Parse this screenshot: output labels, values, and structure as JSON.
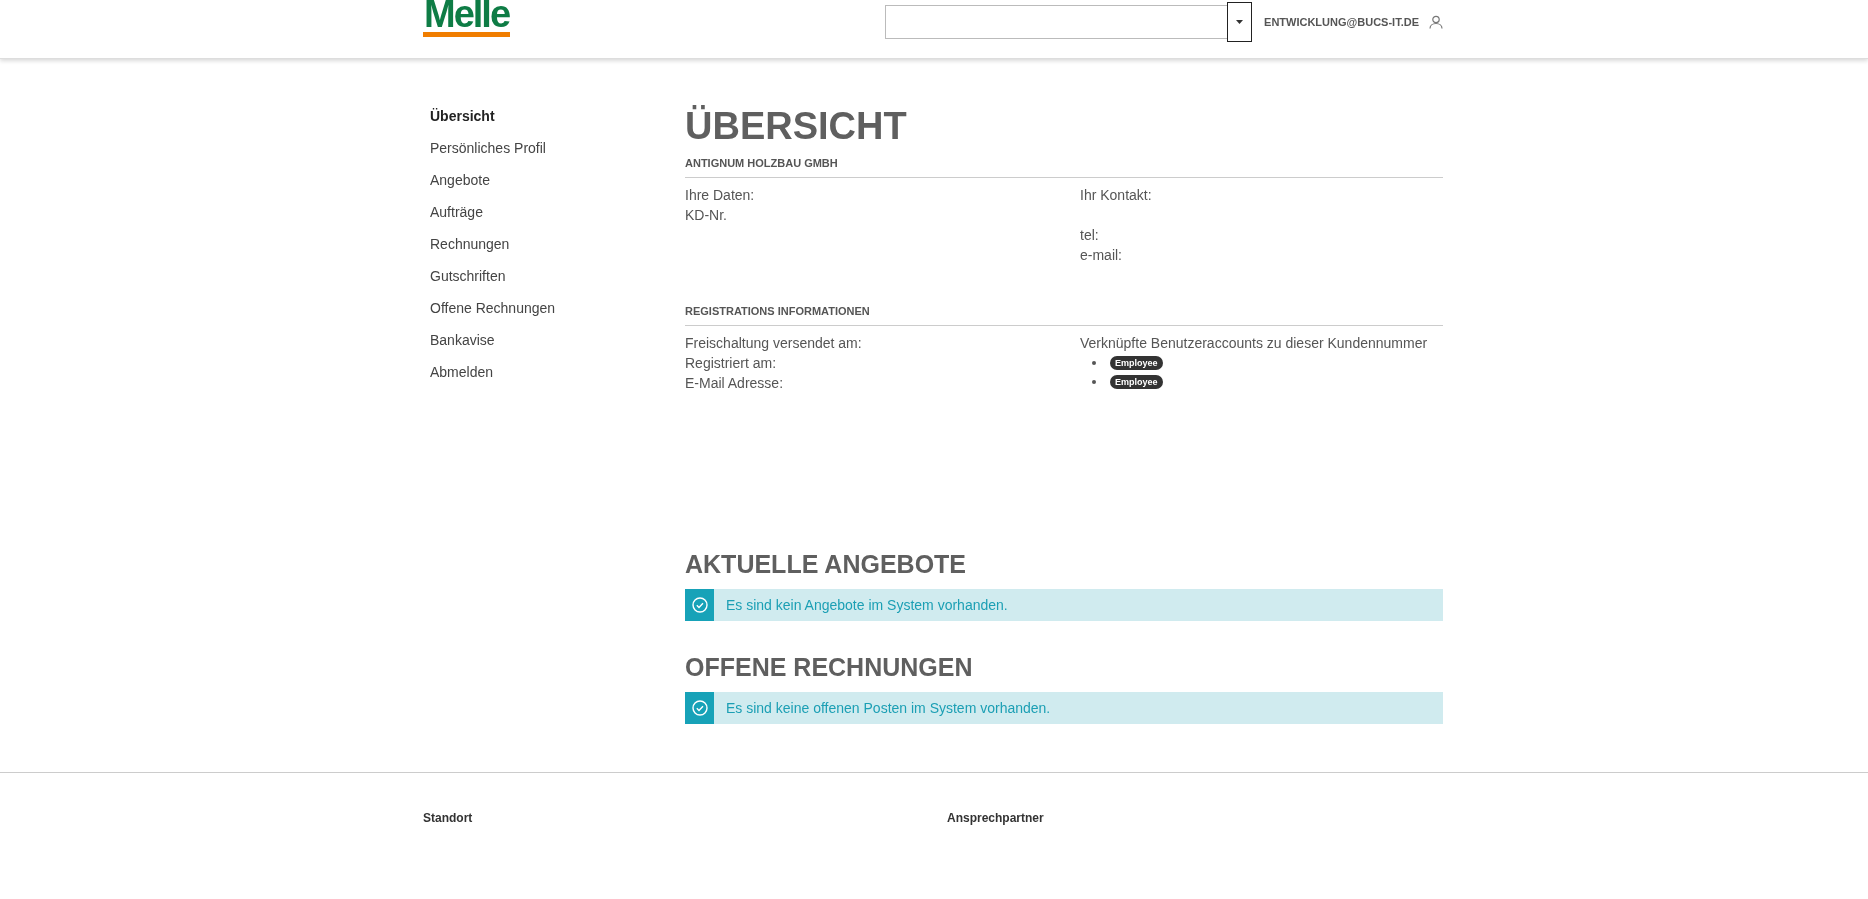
{
  "header": {
    "logo": "Melle",
    "account": "ENTWICKLUNG@BUCS-IT.DE"
  },
  "sidebar": {
    "groups": [
      {
        "items": [
          {
            "label": "Übersicht",
            "selected": true
          },
          {
            "label": "Persönliches Profil",
            "selected": false
          }
        ]
      },
      {
        "items": [
          {
            "label": "Angebote",
            "selected": false
          },
          {
            "label": "Aufträge",
            "selected": false
          },
          {
            "label": "Rechnungen",
            "selected": false
          },
          {
            "label": "Gutschriften",
            "selected": false
          },
          {
            "label": "Offene Rechnungen",
            "selected": false
          },
          {
            "label": "Bankavise",
            "selected": false
          }
        ]
      },
      {
        "items": [
          {
            "label": "Abmelden",
            "selected": false
          }
        ]
      }
    ]
  },
  "overview": {
    "title": "ÜBERSICHT",
    "company": {
      "heading": "ANTIGNUM HOLZBAU GMBH",
      "left": [
        "Ihre Daten:",
        "KD-Nr."
      ],
      "contact": {
        "title": "Ihr Kontakt:",
        "lines": [
          "tel:",
          "e-mail:"
        ]
      }
    },
    "registration": {
      "heading": "REGISTRATIONS INFORMATIONEN",
      "left": [
        "Freischaltung versendet am:",
        "Registriert am:",
        "E-Mail Adresse:"
      ],
      "right_title": "Verknüpfte Benutzeraccounts zu dieser Kundennummer",
      "accounts": [
        "Employee",
        "Employee"
      ]
    }
  },
  "sections": [
    {
      "title": "AKTUELLE ANGEBOTE",
      "message": "Es sind kein Angebote im System vorhanden."
    },
    {
      "title": "OFFENE RECHNUNGEN",
      "message": "Es sind keine offenen Posten im System vorhanden."
    }
  ],
  "footer": {
    "columns": [
      "Standort",
      "Ansprechpartner"
    ]
  }
}
